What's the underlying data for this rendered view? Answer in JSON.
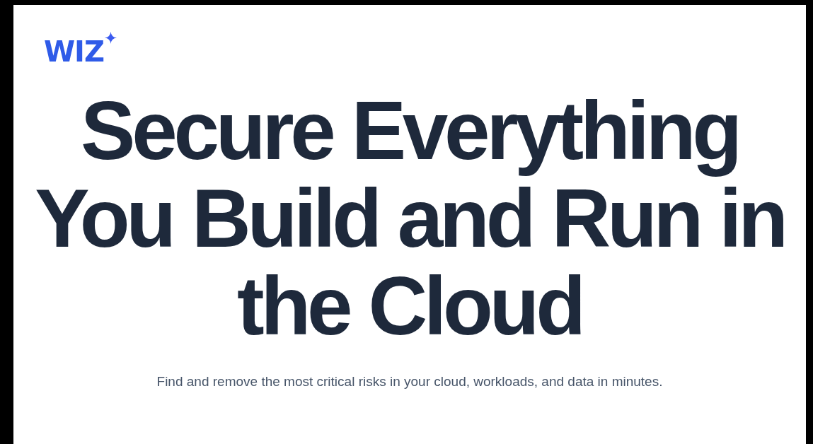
{
  "logo": {
    "text": "WIZ"
  },
  "hero": {
    "heading": "Secure Everything You Build and Run in the Cloud",
    "subheading": "Find and remove the most critical risks in your cloud, workloads, and data in minutes."
  }
}
